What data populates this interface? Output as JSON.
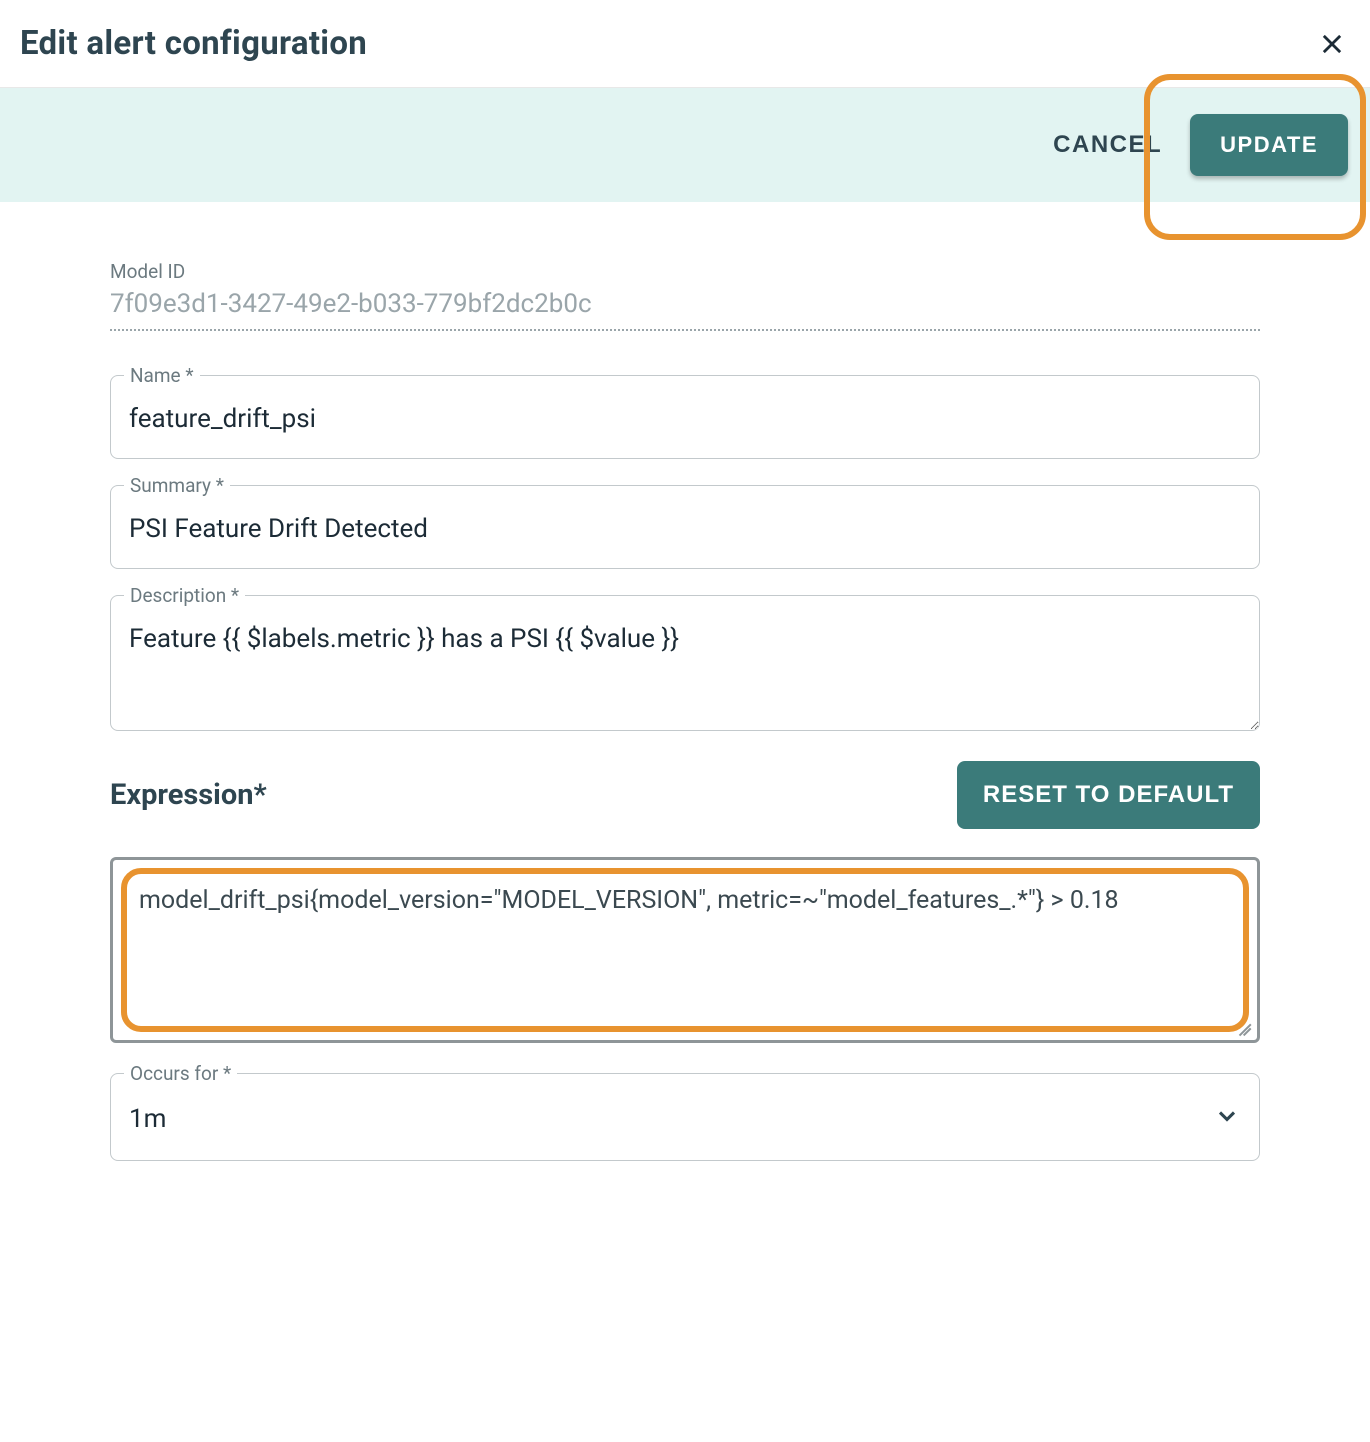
{
  "header": {
    "title": "Edit alert configuration"
  },
  "actions": {
    "cancel": "CANCEL",
    "update": "UPDATE"
  },
  "form": {
    "model_id_label": "Model ID",
    "model_id_value": "7f09e3d1-3427-49e2-b033-779bf2dc2b0c",
    "name_label": "Name *",
    "name_value": "feature_drift_psi",
    "summary_label": "Summary *",
    "summary_value": "PSI Feature Drift Detected",
    "description_label": "Description *",
    "description_value": "Feature {{ $labels.metric }} has a PSI {{ $value }}",
    "expression_label": "Expression*",
    "reset_label": "RESET TO DEFAULT",
    "expression_value": "model_drift_psi{model_version=\"MODEL_VERSION\", metric=~\"model_features_.*\"} > 0.18",
    "occurs_label": "Occurs for *",
    "occurs_value": "1m"
  }
}
